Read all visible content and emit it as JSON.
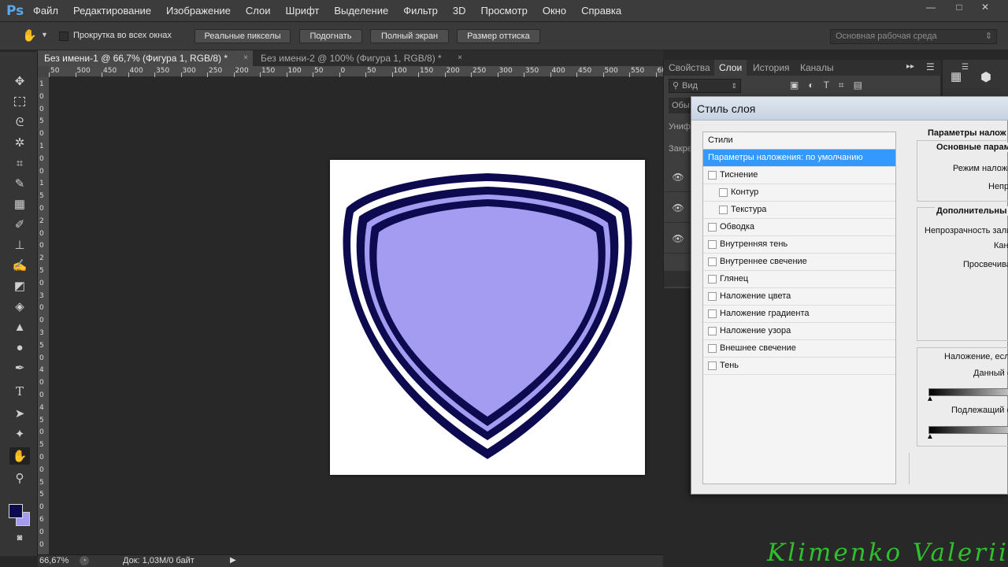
{
  "app": {
    "logo": "Ps",
    "menu": [
      "Файл",
      "Редактирование",
      "Изображение",
      "Слои",
      "Шрифт",
      "Выделение",
      "Фильтр",
      "3D",
      "Просмотр",
      "Окно",
      "Справка"
    ],
    "window_controls": [
      "—",
      "□",
      "✕"
    ]
  },
  "options_bar": {
    "tool_icon": "hand-icon",
    "scroll_all_label": "Прокрутка во всех окнах",
    "buttons": [
      "Реальные пикселы",
      "Подогнать",
      "Полный экран",
      "Размер оттиска"
    ],
    "workspace": "Основная рабочая среда"
  },
  "documents": {
    "tabs": [
      {
        "label": "Без имени-1 @ 66,7% (Фигура 1, RGB/8) *",
        "active": true
      },
      {
        "label": "Без имени-2 @ 100% (Фигура 1, RGB/8) *",
        "active": false
      }
    ],
    "close_glyph": "×"
  },
  "ruler": {
    "h_ticks": [
      "50",
      "500",
      "450",
      "400",
      "350",
      "300",
      "250",
      "200",
      "150",
      "100",
      "50",
      "0",
      "50",
      "100",
      "150",
      "200",
      "250",
      "300",
      "350",
      "400",
      "450",
      "500",
      "550",
      "600"
    ],
    "v_ticks": [
      "1",
      "0",
      "0",
      "5",
      "0",
      "1",
      "0",
      "0",
      "1",
      "5",
      "0",
      "2",
      "0",
      "0",
      "2",
      "5",
      "0",
      "3",
      "0",
      "0",
      "3",
      "5",
      "0",
      "4",
      "0",
      "0",
      "4",
      "5",
      "0",
      "5",
      "0",
      "0",
      "5",
      "5",
      "0",
      "6",
      "0",
      "0"
    ]
  },
  "shield": {
    "outer_stroke": "#0d0a50",
    "fill": "#a39cf0",
    "gap": "#ffffff"
  },
  "status": {
    "zoom": "66,67%",
    "doc_info": "Док: 1,03M/0 байт"
  },
  "panels": {
    "tabs": [
      "Свойства",
      "Слои",
      "История",
      "Каналы"
    ],
    "active_tab": "Слои",
    "filter": "Вид",
    "row_labels": [
      "Обы",
      "Униф",
      "Закре"
    ]
  },
  "dialog": {
    "title": "Стиль слоя",
    "styles_header": "Стили",
    "items": [
      {
        "label": "Параметры наложения: по умолчанию",
        "checkbox": false,
        "selected": true,
        "indent": 0
      },
      {
        "label": "Тиснение",
        "checkbox": true,
        "selected": false,
        "indent": 0
      },
      {
        "label": "Контур",
        "checkbox": true,
        "selected": false,
        "indent": 1
      },
      {
        "label": "Текстура",
        "checkbox": true,
        "selected": false,
        "indent": 1
      },
      {
        "label": "Обводка",
        "checkbox": true,
        "selected": false,
        "indent": 0
      },
      {
        "label": "Внутренняя тень",
        "checkbox": true,
        "selected": false,
        "indent": 0
      },
      {
        "label": "Внутреннее свечение",
        "checkbox": true,
        "selected": false,
        "indent": 0
      },
      {
        "label": "Глянец",
        "checkbox": true,
        "selected": false,
        "indent": 0
      },
      {
        "label": "Наложение цвета",
        "checkbox": true,
        "selected": false,
        "indent": 0
      },
      {
        "label": "Наложение градиента",
        "checkbox": true,
        "selected": false,
        "indent": 0
      },
      {
        "label": "Наложение узора",
        "checkbox": true,
        "selected": false,
        "indent": 0
      },
      {
        "label": "Внешнее свечение",
        "checkbox": true,
        "selected": false,
        "indent": 0
      },
      {
        "label": "Тень",
        "checkbox": true,
        "selected": false,
        "indent": 0
      }
    ],
    "right": {
      "section_title": "Параметры налож",
      "basic_group": "Основные парам",
      "blend_mode_label": "Режим наложе",
      "opacity_label": "Непр",
      "advanced_group": "Дополнительны",
      "fill_opacity_label": "Непрозрачность зали",
      "channels_label": "Кан",
      "knockout_label": "Просвечива",
      "blend_if_label": "Наложение, есл",
      "this_layer_label": "Данный с",
      "underlying_label": "Подлежащий с"
    }
  },
  "watermark": "Klimenko Valerii"
}
